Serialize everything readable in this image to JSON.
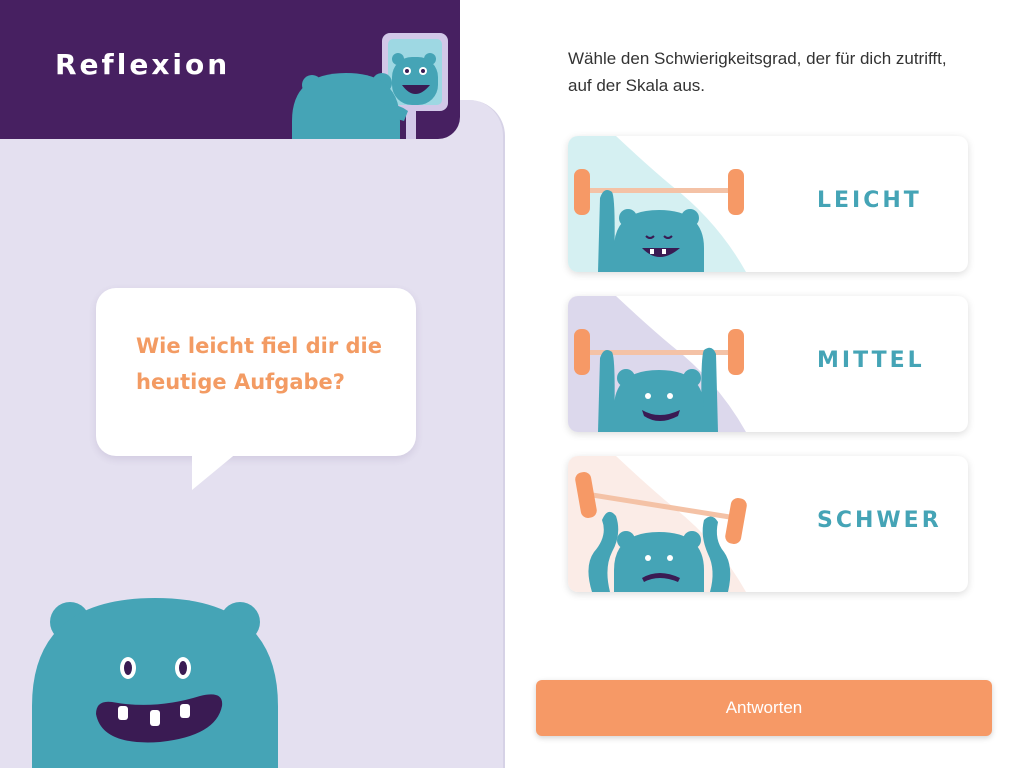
{
  "header": {
    "title": "Reflexion"
  },
  "bubble": {
    "question": "Wie leicht fiel dir die heutige Aufgabe?"
  },
  "instruction": "Wähle den Schwierigkeitsgrad, der für dich zutrifft, auf der Skala aus.",
  "options": [
    {
      "label": "LEICHT",
      "illustration": "monster-lifting-light-icon"
    },
    {
      "label": "MITTEL",
      "illustration": "monster-lifting-medium-icon"
    },
    {
      "label": "SCHWER",
      "illustration": "monster-lifting-heavy-icon"
    }
  ],
  "submit": {
    "label": "Antworten"
  },
  "colors": {
    "header": "#472061",
    "panel": "#e4e0f0",
    "accent_orange": "#f39b63",
    "teal": "#45a4b6",
    "button": "#f69966"
  }
}
